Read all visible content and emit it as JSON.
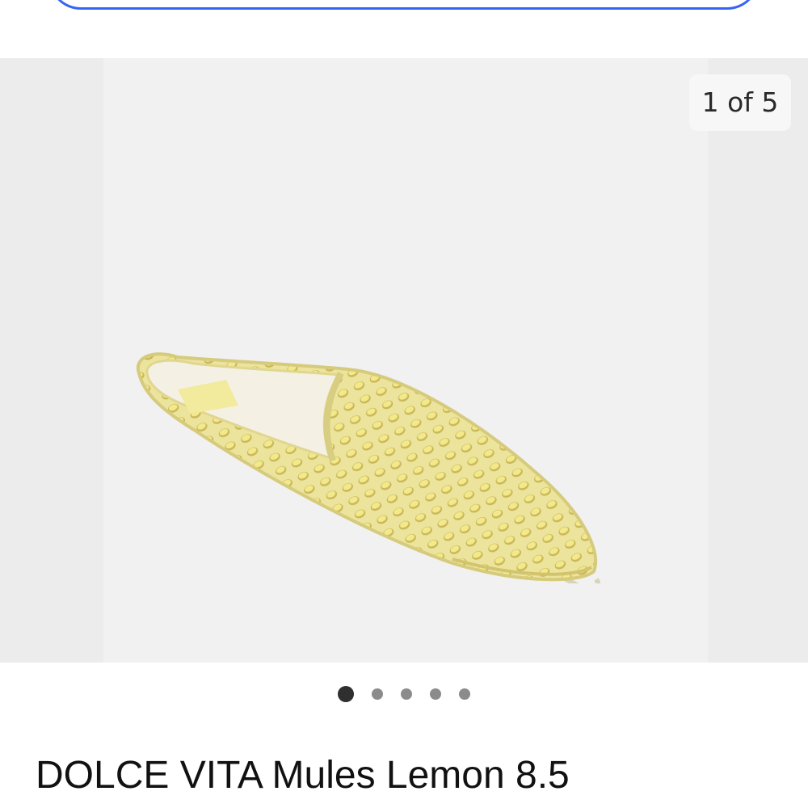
{
  "gallery": {
    "counter": "1 of 5",
    "current_index": 1,
    "total_images": 5,
    "image_alt": "Yellow perforated pointed-toe mule"
  },
  "product": {
    "title": "DOLCE VITA Mules Lemon 8.5"
  },
  "colors": {
    "accent": "#3665f3",
    "shoe": "#ede39a",
    "gallery_bg": "#ececec"
  }
}
